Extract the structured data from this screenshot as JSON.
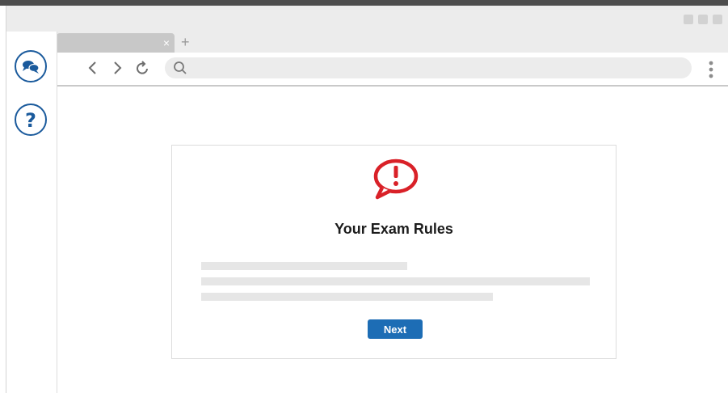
{
  "window": {
    "controls": [
      "minimize",
      "maximize",
      "close"
    ]
  },
  "tabs": {
    "close_glyph": "×",
    "new_tab_glyph": "+"
  },
  "toolbar": {
    "back_icon": "chevron-left-icon",
    "forward_icon": "chevron-right-icon",
    "reload_icon": "reload-icon",
    "search_icon": "search-icon",
    "address_value": "",
    "menu_icon": "kebab-menu-icon"
  },
  "sidebar": {
    "items": [
      {
        "icon": "chat-bubbles-icon"
      },
      {
        "icon": "help-icon",
        "label": "?"
      }
    ]
  },
  "dialog": {
    "icon": "alert-speech-bubble-icon",
    "title": "Your Exam Rules",
    "next_label": "Next"
  },
  "colors": {
    "accent": "#1d6db5",
    "alert": "#d92128",
    "sidebar_icon": "#1a5a9c"
  }
}
